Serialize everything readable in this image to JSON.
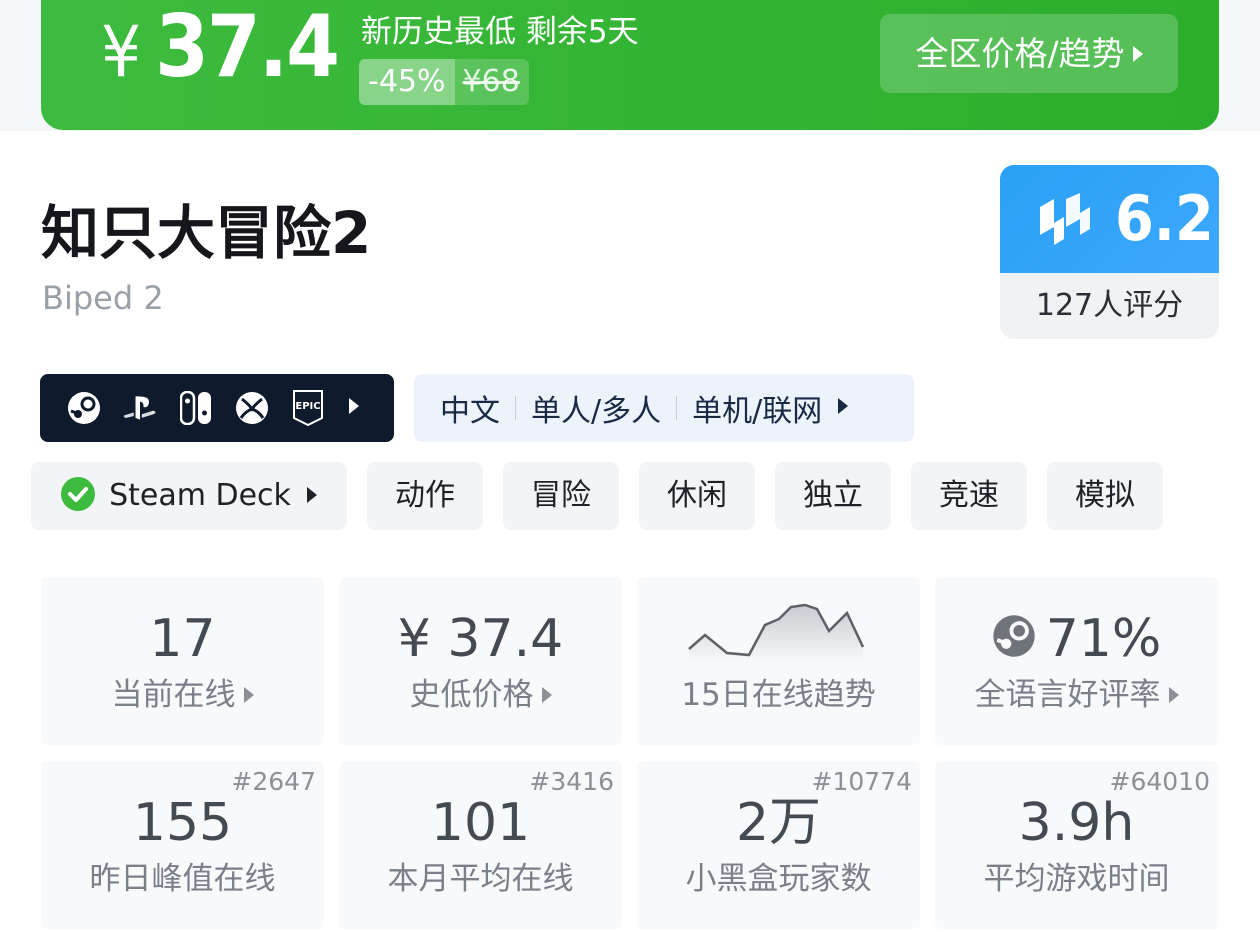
{
  "price_banner": {
    "currency": "¥",
    "current_price": "37.4",
    "lowest_note": "新历史最低 剩余5天",
    "discount": "-45%",
    "original_price": "¥68",
    "trend_button": "全区价格/趋势"
  },
  "game": {
    "title": "知只大冒险2",
    "english_title": "Biped 2"
  },
  "score": {
    "value": "6.2",
    "count_label": "127人评分"
  },
  "platforms": {
    "icons": [
      "steam-icon",
      "playstation-icon",
      "switch-icon",
      "xbox-icon",
      "epic-games-icon"
    ]
  },
  "features": [
    "中文",
    "单人/多人",
    "单机/联网"
  ],
  "tags": [
    {
      "label": "Steam Deck",
      "verified": true
    },
    {
      "label": "动作"
    },
    {
      "label": "冒险"
    },
    {
      "label": "休闲"
    },
    {
      "label": "独立"
    },
    {
      "label": "竞速"
    },
    {
      "label": "模拟"
    }
  ],
  "stats_row1": [
    {
      "value": "17",
      "label": "当前在线"
    },
    {
      "value": "¥ 37.4",
      "label": "史低价格"
    },
    {
      "label": "15日在线趋势"
    },
    {
      "value": "71%",
      "label": "全语言好评率"
    }
  ],
  "stats_row2": [
    {
      "value": "155",
      "label": "昨日峰值在线",
      "rank": "#2647"
    },
    {
      "value": "101",
      "label": "本月平均在线",
      "rank": "#3416"
    },
    {
      "value": "2万",
      "label": "小黑盒玩家数",
      "rank": "#10774"
    },
    {
      "value": "3.9h",
      "label": "平均游戏时间",
      "rank": "#64010"
    }
  ],
  "colors": {
    "banner_green": "#2fb12f",
    "score_blue": "#2aa1f5",
    "platform_bg": "#101a2d",
    "feature_bg": "#edf3fb"
  }
}
